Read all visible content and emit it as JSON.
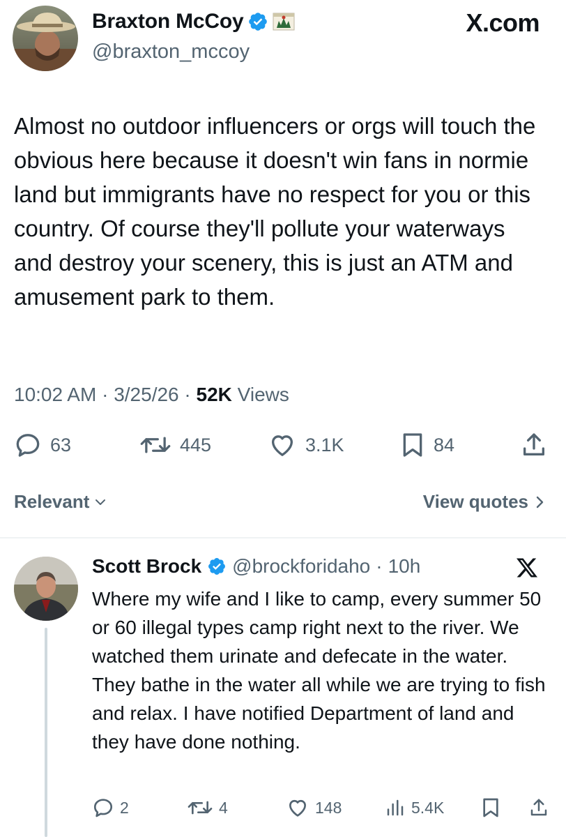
{
  "source": {
    "label": "X.com"
  },
  "main_post": {
    "author_name": "Braxton McCoy",
    "handle": "@braxton_mccoy",
    "text": "Almost no outdoor influencers or orgs will touch the obvious here because it doesn't win fans in normie land but immigrants have no respect for you or this country. Of course they'll pollute your waterways and destroy your scenery, this is just an ATM and amusement park to them.",
    "time": "10:02 AM",
    "date": "3/25/26",
    "separator": "·",
    "views_count": "52K",
    "views_label": "Views",
    "replies": "63",
    "reposts": "445",
    "likes": "3.1K",
    "bookmarks": "84"
  },
  "replies_bar": {
    "sort_label": "Relevant",
    "quotes_label": "View quotes"
  },
  "reply": {
    "author_name": "Scott Brock",
    "handle": "@brockforidaho",
    "separator": "·",
    "time": "10h",
    "text": "Where my wife and I like to camp, every summer 50 or 60 illegal types camp right next to the river. We watched them urinate and defecate in the water. They bathe in the water all while we are trying to fish and relax. I have notified Department of land and they have done nothing.",
    "replies": "2",
    "reposts": "4",
    "likes": "148",
    "views": "5.4K"
  },
  "colors": {
    "text": "#0f1419",
    "secondary": "#536471",
    "verified": "#1d9bf0",
    "divider": "#eff3f4"
  },
  "icons": {
    "verified": "verified-badge-icon",
    "flag": "flag-icon",
    "reply": "speech-bubble-icon",
    "repost": "repost-arrows-icon",
    "like": "heart-icon",
    "bookmark": "bookmark-icon",
    "share": "share-upload-icon",
    "views": "bar-chart-icon",
    "x_logo": "x-logo-icon"
  }
}
